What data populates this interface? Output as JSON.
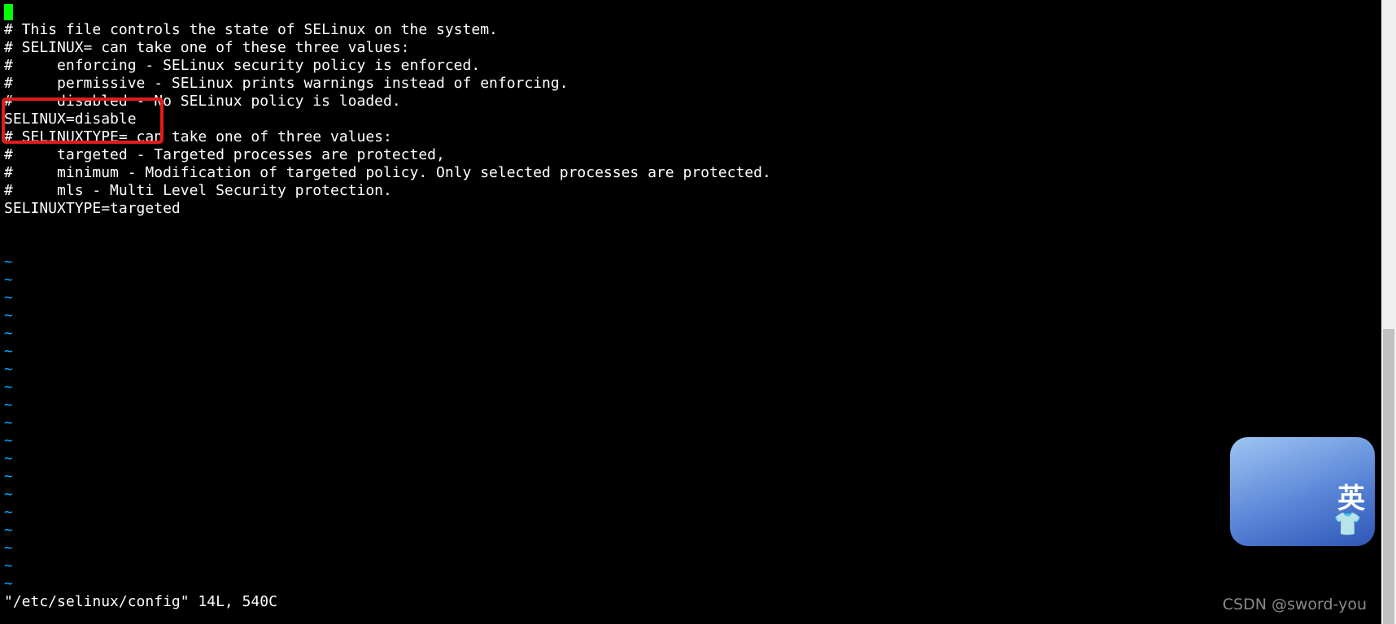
{
  "editor": {
    "lines": [
      "",
      "# This file controls the state of SELinux on the system.",
      "# SELINUX= can take one of these three values:",
      "#     enforcing - SELinux security policy is enforced.",
      "#     permissive - SELinux prints warnings instead of enforcing.",
      "#     disabled - No SELinux policy is loaded.",
      "SELINUX=disable",
      "# SELINUXTYPE= can take one of three values:",
      "#     targeted - Targeted processes are protected,",
      "#     minimum - Modification of targeted policy. Only selected processes are protected.",
      "#     mls - Multi Level Security protection.",
      "SELINUXTYPE=targeted",
      ""
    ],
    "tilde_char": "~",
    "tilde_count": 19,
    "status_line": "\"/etc/selinux/config\" 14L, 540C"
  },
  "ime_widget": {
    "char": "英",
    "icon": "shirt-icon"
  },
  "watermark": "CSDN @sword-you",
  "colors": {
    "background": "#000000",
    "text": "#ffffff",
    "tilde": "#00aaff",
    "cursor": "#00ff00",
    "highlight": "#e11b1b"
  }
}
